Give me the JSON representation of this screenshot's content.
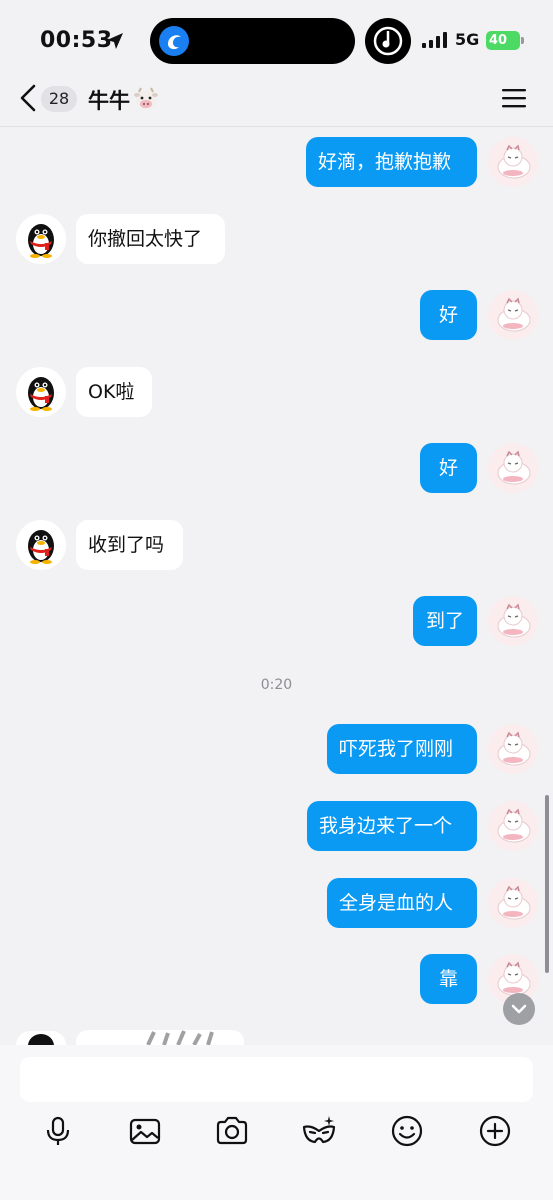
{
  "status_bar": {
    "time": "00:53",
    "network": "5G",
    "battery": "40"
  },
  "header": {
    "unread_count": "28",
    "title": "牛牛"
  },
  "messages": [
    {
      "side": "me",
      "text": "好滴，抱歉抱歉"
    },
    {
      "side": "other",
      "text": "你撤回太快了"
    },
    {
      "side": "me",
      "text": "好"
    },
    {
      "side": "other",
      "text": "OK啦"
    },
    {
      "side": "me",
      "text": "好"
    },
    {
      "side": "other",
      "text": "收到了吗"
    },
    {
      "side": "me",
      "text": "到了"
    },
    {
      "side": "me",
      "text": "吓死我了刚刚"
    },
    {
      "side": "me",
      "text": "我身边来了一个"
    },
    {
      "side": "me",
      "text": "全身是血的人"
    },
    {
      "side": "me",
      "text": "靠"
    }
  ],
  "timestamp": "0:20",
  "toolbar": [
    "microphone-icon",
    "image-icon",
    "camera-icon",
    "mask-icon",
    "emoji-icon",
    "plus-icon"
  ],
  "colors": {
    "my_bubble": "#0a9af4",
    "other_bubble": "#ffffff",
    "background": "#f2f2f4"
  }
}
